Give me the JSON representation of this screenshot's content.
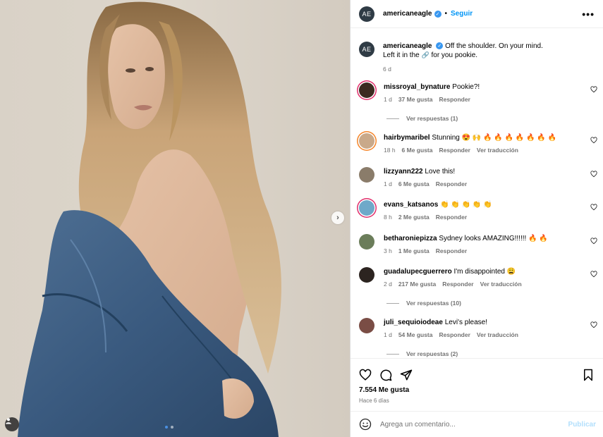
{
  "post": {
    "account": "americaneagle",
    "avatar_initials": "AE",
    "follow_label": "Seguir",
    "bullet": "•",
    "more_label": "•••",
    "caption_line1": "Off the shoulder. On your mind.",
    "caption_line2_a": "Left it in the",
    "caption_line2_emoji": "🔗",
    "caption_line2_b": "for you pookie.",
    "caption_time": "6 d"
  },
  "comments": [
    {
      "user": "missroyal_bynature",
      "text": "Pookie?!",
      "time": "1 d",
      "likes": "37 Me gusta",
      "reply": "Responder",
      "translate": "",
      "replies": "Ver respuestas (1)",
      "avatar": "#3b2a20"
    },
    {
      "user": "hairbymaribel",
      "text": "Stunning 😍 🙌 🔥 🔥 🔥 🔥 🔥 🔥 🔥",
      "time": "18 h",
      "likes": "6 Me gusta",
      "reply": "Responder",
      "translate": "Ver traducción",
      "replies": "",
      "avatar": "#c9a98a"
    },
    {
      "user": "lizzyann222",
      "text": "Love this!",
      "time": "1 d",
      "likes": "6 Me gusta",
      "reply": "Responder",
      "translate": "",
      "replies": "",
      "avatar": "#8a7c6a"
    },
    {
      "user": "evans_katsanos",
      "text": "👏 👏 👏 👏 👏",
      "time": "8 h",
      "likes": "2 Me gusta",
      "reply": "Responder",
      "translate": "",
      "replies": "",
      "avatar": "#6fa9c9"
    },
    {
      "user": "betharoniepizza",
      "text": "Sydney looks AMAZING!!!!!! 🔥 🔥",
      "time": "3 h",
      "likes": "1 Me gusta",
      "reply": "Responder",
      "translate": "",
      "replies": "",
      "avatar": "#6b7d5a"
    },
    {
      "user": "guadalupecguerrero",
      "text": "I'm disappointed 😩",
      "time": "2 d",
      "likes": "217 Me gusta",
      "reply": "Responder",
      "translate": "Ver traducción",
      "replies": "Ver respuestas (10)",
      "avatar": "#2c2420"
    },
    {
      "user": "juli_sequioiodeae",
      "text": "Levi's please!",
      "time": "1 d",
      "likes": "54 Me gusta",
      "reply": "Responder",
      "translate": "Ver traducción",
      "replies": "Ver respuestas (2)",
      "avatar": "#7a4d45"
    }
  ],
  "stats": {
    "likes": "7.554 Me gusta",
    "ago": "Hace 6 días"
  },
  "composer": {
    "placeholder": "Agrega un comentario...",
    "publish": "Publicar"
  },
  "colors": {
    "follow": "#0095f6",
    "verified": "#3897f0",
    "publish_disabled": "#b2dffc",
    "muted": "#737373"
  },
  "icons": [
    "next-icon",
    "tag-user-icon",
    "verified-icon",
    "more-icon",
    "heart-icon",
    "comment-icon",
    "share-icon",
    "save-icon",
    "emoji-icon"
  ]
}
